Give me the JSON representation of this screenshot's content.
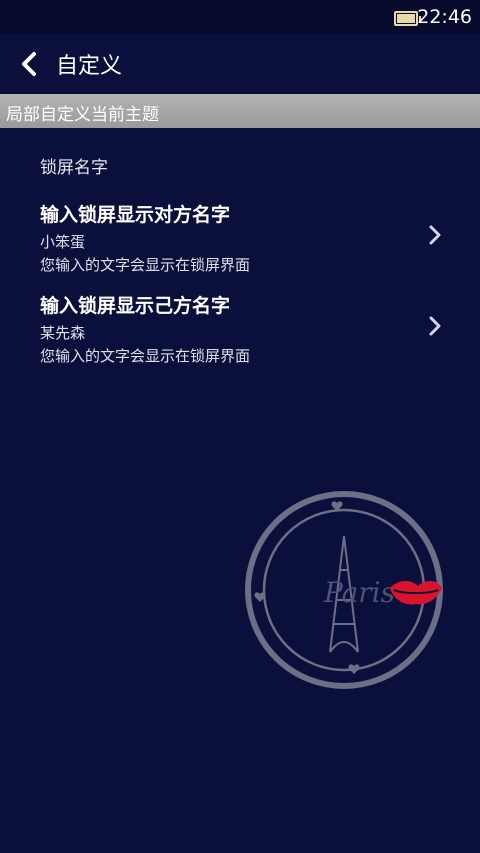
{
  "status_bar": {
    "time": "22:46",
    "battery_icon": "battery-icon"
  },
  "header": {
    "back_icon": "chevron-left-icon",
    "title": "自定义"
  },
  "section": {
    "title": "局部自定义当前主题"
  },
  "group": {
    "title": "锁屏名字"
  },
  "items": [
    {
      "title": "输入锁屏显示对方名字",
      "value": "小笨蛋",
      "hint": "您输入的文字会显示在锁屏界面",
      "icon": "chevron-right-icon"
    },
    {
      "title": "输入锁屏显示己方名字",
      "value": "某先森",
      "hint": "您输入的文字会显示在锁屏界面",
      "icon": "chevron-right-icon"
    }
  ],
  "decoration": {
    "icon": "paris-eiffel-emblem-icon",
    "script_text": "Paris",
    "lips_color": "#d8152c"
  }
}
